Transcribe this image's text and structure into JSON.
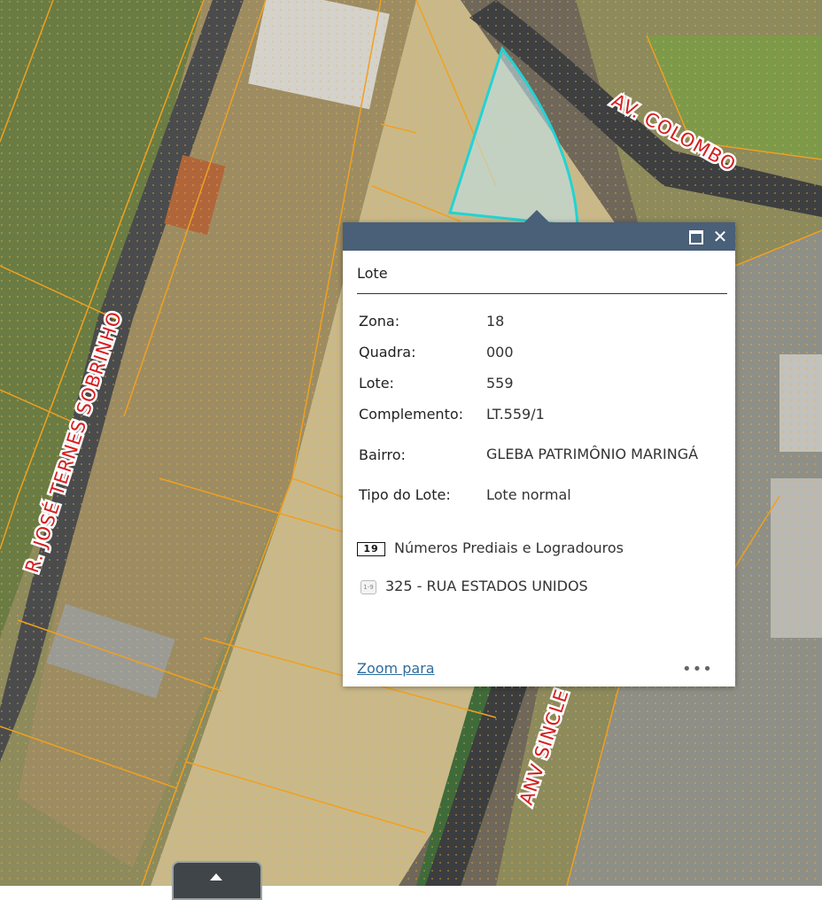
{
  "map": {
    "street_labels": [
      "AV. COLOMBO",
      "R. JOSÉ TERNES SOBRINHO",
      "ANV SINCLE"
    ]
  },
  "popup": {
    "title": "Lote",
    "attributes": [
      {
        "key": "Zona:",
        "value": "18"
      },
      {
        "key": "Quadra:",
        "value": "000"
      },
      {
        "key": "Lote:",
        "value": "559"
      },
      {
        "key": "Complemento:",
        "value": "LT.559/1"
      },
      {
        "key": "Bairro:",
        "value": "GLEBA PATRIMÔNIO MARINGÁ"
      },
      {
        "key": "Tipo do Lote:",
        "value": "Lote normal"
      }
    ],
    "related_icon_text": "19",
    "related_label": "Números Prediais e Logradouros",
    "record_icon_text": "1-9",
    "record_label": "325 - RUA ESTADOS UNIDOS",
    "zoom_label": "Zoom para",
    "more_label": "•••",
    "close_label": "✕"
  },
  "colors": {
    "header": "#4a5f78",
    "selection_outline": "#22d3d3",
    "parcel_lines": "#f0a020",
    "street_label": "#d61f1f",
    "link": "#2f6d9e"
  }
}
